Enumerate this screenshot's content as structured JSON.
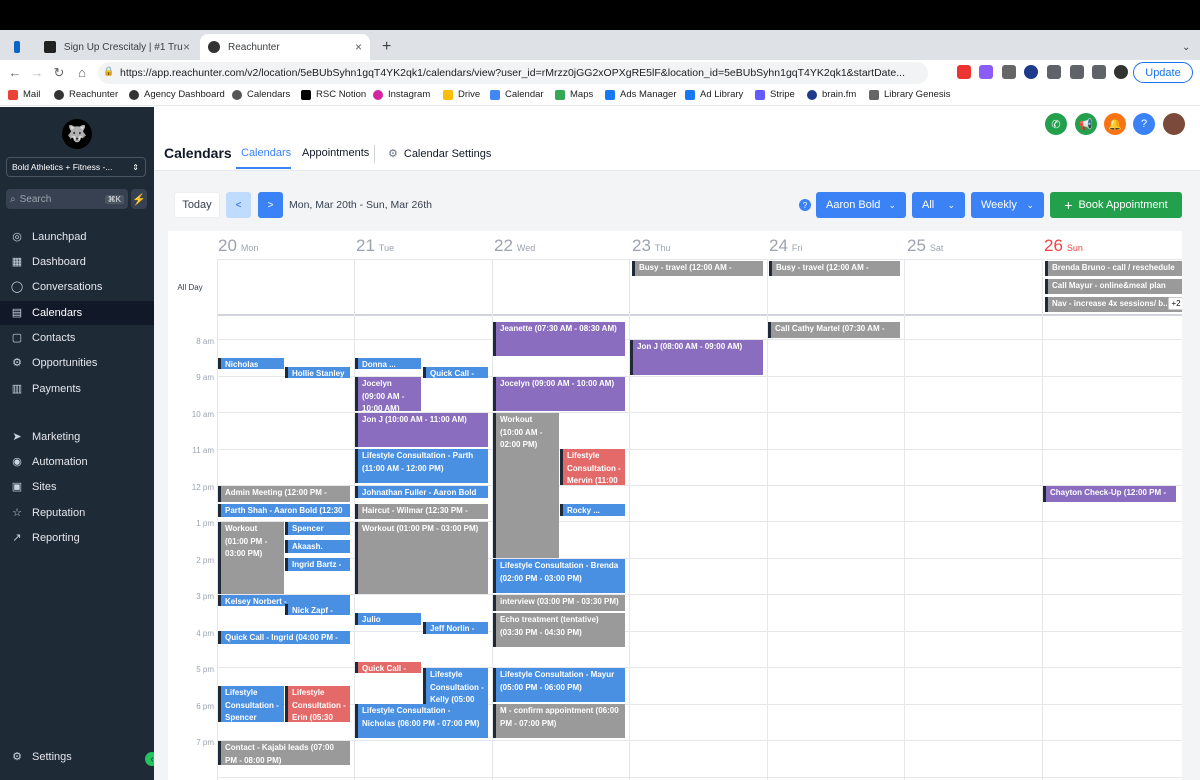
{
  "browser": {
    "tabs": [
      {
        "title": "Sign Up Crescitaly | #1 Trusted"
      },
      {
        "title": "Reachunter"
      }
    ],
    "url": "https://app.reachunter.com/v2/location/5eBUbSyhn1gqT4YK2qk1/calendars/view?user_id=rMrzz0jGG2xOPXgRE5lF&location_id=5eBUbSyhn1gqT4YK2qk1&startDate...",
    "update_label": "Update",
    "bookmarks": [
      "Mail",
      "Reachunter",
      "Agency Dashboard",
      "Calendars",
      "RSC Notion",
      "Instagram",
      "Drive",
      "Calendar",
      "Maps",
      "Ads Manager",
      "Ad Library",
      "Stripe",
      "brain.fm",
      "Library Genesis"
    ]
  },
  "sidebar": {
    "account": "Bold Athletics + Fitness -...",
    "search_placeholder": "Search",
    "search_kbd": "⌘K",
    "items": [
      {
        "label": "Launchpad"
      },
      {
        "label": "Dashboard"
      },
      {
        "label": "Conversations"
      },
      {
        "label": "Calendars"
      },
      {
        "label": "Contacts"
      },
      {
        "label": "Opportunities"
      },
      {
        "label": "Payments"
      },
      {
        "label": "Marketing"
      },
      {
        "label": "Automation"
      },
      {
        "label": "Sites"
      },
      {
        "label": "Reputation"
      },
      {
        "label": "Reporting"
      },
      {
        "label": "Settings"
      }
    ]
  },
  "header": {
    "title": "Calendars",
    "tabs": [
      "Calendars",
      "Appointments",
      "Calendar Settings"
    ]
  },
  "toolbar": {
    "today": "Today",
    "prev": "<",
    "next": ">",
    "range": "Mon, Mar 20th - Sun, Mar 26th",
    "user_filter": "Aaron Bold",
    "type_filter": "All",
    "view": "Weekly",
    "book": "Book Appointment"
  },
  "calendar": {
    "all_day_label": "All Day",
    "more": "+2",
    "days": [
      {
        "num": "20",
        "name": "Mon"
      },
      {
        "num": "21",
        "name": "Tue"
      },
      {
        "num": "22",
        "name": "Wed"
      },
      {
        "num": "23",
        "name": "Thu"
      },
      {
        "num": "24",
        "name": "Fri"
      },
      {
        "num": "25",
        "name": "Sat"
      },
      {
        "num": "26",
        "name": "Sun"
      }
    ],
    "hours": [
      "8 am",
      "9 am",
      "10 am",
      "11 am",
      "12 pm",
      "1 pm",
      "2 pm",
      "3 pm",
      "4 pm",
      "5 pm",
      "6 pm",
      "7 pm"
    ],
    "events": [
      {
        "text": "Busy - travel (12:00 AM - 12:00..."
      },
      {
        "text": "Busy - travel (12:00 AM - 12:00..."
      },
      {
        "text": "Brenda Bruno - call / reschedule ..."
      },
      {
        "text": "Call Mayur - online&meal plan (1..."
      },
      {
        "text": "Nav - increase 4x sessions/ b..."
      },
      {
        "text": "Nicholas"
      },
      {
        "text": "Hollie Stanley -"
      },
      {
        "text": "Kelsey Norbert -"
      },
      {
        "text": "Admin Meeting (12:00 PM -"
      },
      {
        "text": "Parth Shah - Aaron Bold (12:30"
      },
      {
        "text": "Workout (01:00 PM - 03:00 PM)"
      },
      {
        "text": "Spencer Brown"
      },
      {
        "text": "Akaash."
      },
      {
        "text": "Ingrid Bartz -"
      },
      {
        "text": "Nick Zapf -"
      },
      {
        "text": "Quick Call - Ingrid (04:00 PM -"
      },
      {
        "text": "Lifestyle Consultation - Spencer (05:30"
      },
      {
        "text": "Lifestyle Consultation - Erin (05:30 PM"
      },
      {
        "text": "Contact - Kajabi leads (07:00 PM - 08:00 PM)"
      },
      {
        "text": "Donna ..."
      },
      {
        "text": "Quick Call -"
      },
      {
        "text": "Jocelyn (09:00 AM - 10:00 AM)"
      },
      {
        "text": "Jon J  (10:00 AM - 11:00 AM)"
      },
      {
        "text": "Lifestyle Consultation - Parth (11:00 AM - 12:00 PM)"
      },
      {
        "text": "Johnathan Fuller - Aaron Bold"
      },
      {
        "text": "Haircut - Wilmar (12:30 PM -"
      },
      {
        "text": "Workout (01:00 PM - 03:00 PM)"
      },
      {
        "text": "Julio Gonzalez"
      },
      {
        "text": "Jeff Norlin -"
      },
      {
        "text": "Quick Call -"
      },
      {
        "text": "Lifestyle Consultation - Kelly (05:00 PM"
      },
      {
        "text": "Lifestyle Consultation - Nicholas (06:00 PM - 07:00 PM)"
      },
      {
        "text": "Jeanette  (07:30 AM - 08:30 AM)"
      },
      {
        "text": "Jocelyn (09:00 AM - 10:00 AM)"
      },
      {
        "text": "Workout (10:00 AM - 02:00 PM)"
      },
      {
        "text": "Lifestyle Consultation - Mervin (11:00"
      },
      {
        "text": "Rocky ..."
      },
      {
        "text": "Lifestyle Consultation - Brenda (02:00 PM - 03:00 PM)"
      },
      {
        "text": "interview (03:00 PM - 03:30 PM)"
      },
      {
        "text": "Echo treatment (tentative) (03:30 PM - 04:30 PM)"
      },
      {
        "text": "Lifestyle Consultation - Mayur (05:00 PM - 06:00 PM)"
      },
      {
        "text": "M - confirm appointment (06:00 PM - 07:00 PM)"
      },
      {
        "text": "Jon J  (08:00 AM - 09:00 AM)"
      },
      {
        "text": "Call Cathy Martel (07:30 AM -"
      },
      {
        "text": "Chayton Check-Up (12:00 PM -"
      }
    ]
  }
}
